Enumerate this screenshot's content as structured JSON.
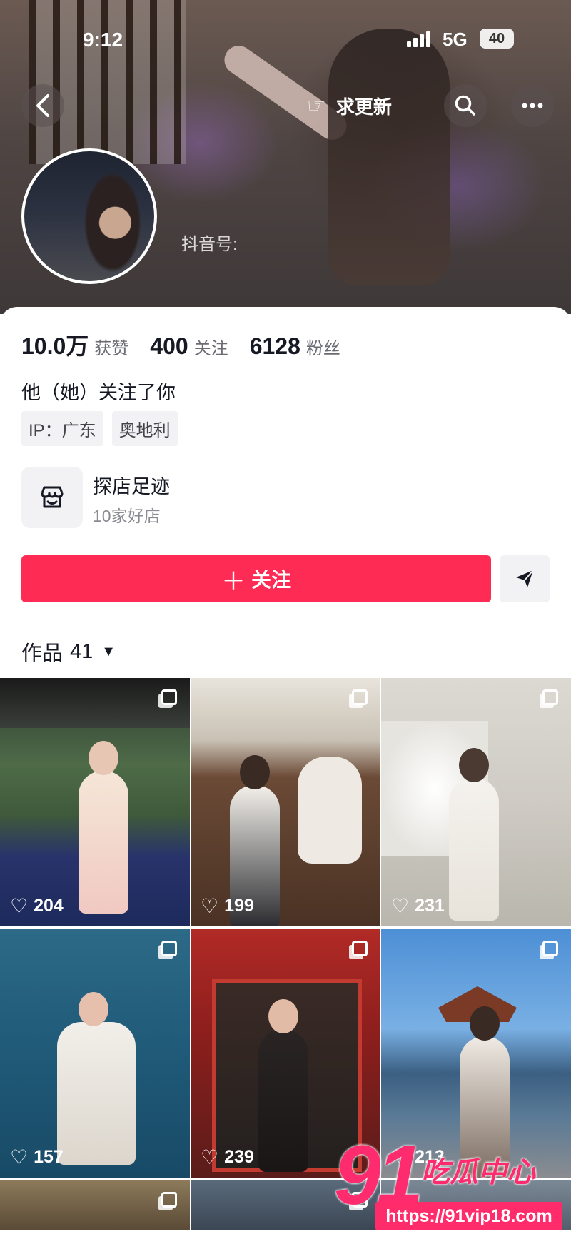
{
  "status_bar": {
    "time": "9:12",
    "network": "5G",
    "battery": "40"
  },
  "header": {
    "urge_update_label": "求更新",
    "douyin_id_label": "抖音号:"
  },
  "stats": [
    {
      "value": "10.0万",
      "label": "获赞"
    },
    {
      "value": "400",
      "label": "关注"
    },
    {
      "value": "6128",
      "label": "粉丝"
    }
  ],
  "profile": {
    "follow_status": "他（她）关注了你",
    "tags": [
      "IP：广东",
      "奥地利"
    ]
  },
  "shop_visit": {
    "title": "探店足迹",
    "subtitle": "10家好店"
  },
  "actions": {
    "follow_label": "关注"
  },
  "works": {
    "tab_label": "作品",
    "count": "41"
  },
  "videos": [
    {
      "likes": "204"
    },
    {
      "likes": "199"
    },
    {
      "likes": "231"
    },
    {
      "likes": "157"
    },
    {
      "likes": "239"
    },
    {
      "likes": "213"
    }
  ],
  "watermark": {
    "logo_number": "91",
    "logo_text": "吃瓜中心",
    "url": "https://91vip18.com"
  },
  "colors": {
    "accent": "#fe2c55",
    "text_primary": "#161823",
    "text_secondary": "#6b6c73",
    "watermark": "#fe2c6e"
  },
  "icons": [
    "back-arrow-icon",
    "pointing-hand-icon",
    "search-icon",
    "more-dots-icon",
    "shop-icon",
    "share-send-icon",
    "caret-down-icon",
    "multi-image-icon",
    "heart-icon"
  ]
}
